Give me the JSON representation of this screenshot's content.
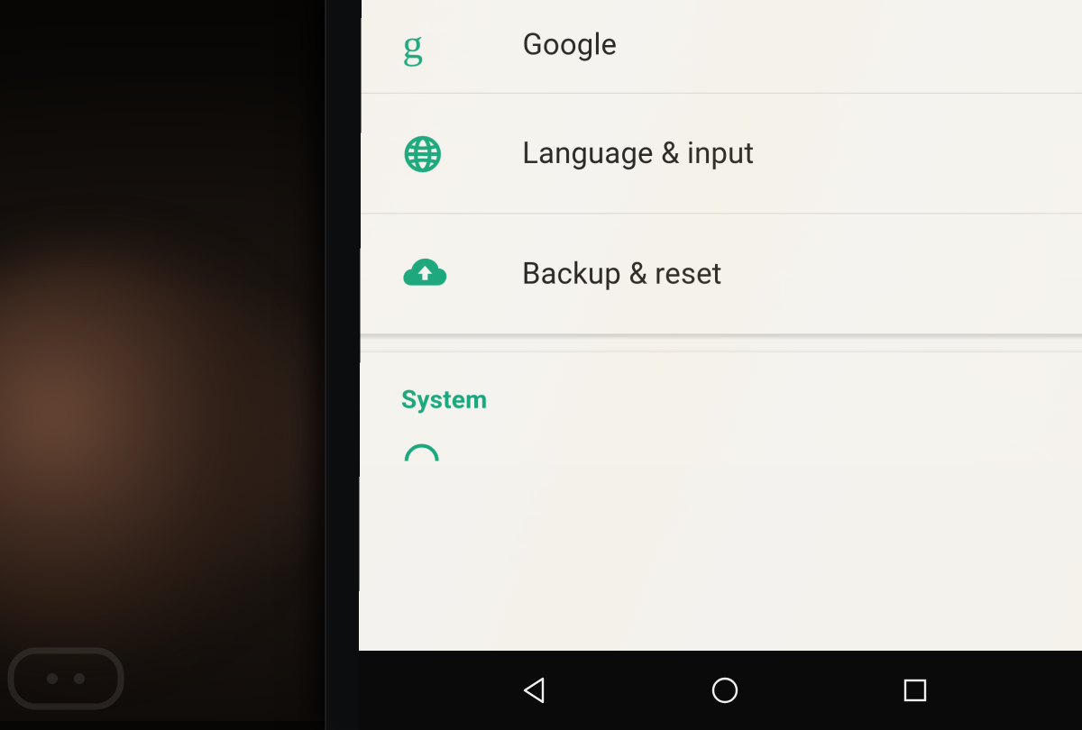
{
  "accent_color": "#1aa77d",
  "settings": {
    "items": [
      {
        "label": "Google",
        "icon": "google"
      },
      {
        "label": "Language & input",
        "icon": "globe"
      },
      {
        "label": "Backup & reset",
        "icon": "cloud-up"
      }
    ],
    "section_header": "System"
  },
  "nav": {
    "back": "back",
    "home": "home",
    "recent": "recent"
  }
}
